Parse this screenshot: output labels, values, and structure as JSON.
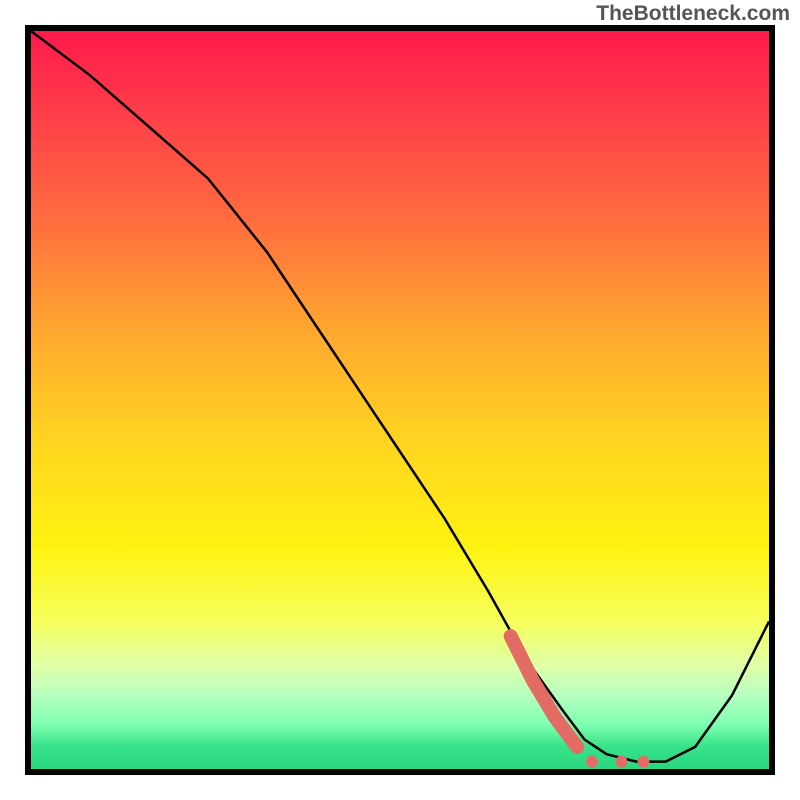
{
  "watermark": "TheBottleneck.com",
  "chart_data": {
    "type": "line",
    "title": "",
    "xlabel": "",
    "ylabel": "",
    "xlim": [
      0,
      100
    ],
    "ylim": [
      0,
      100
    ],
    "series": [
      {
        "name": "bottleneck-curve",
        "x": [
          0,
          8,
          16,
          24,
          32,
          40,
          48,
          56,
          62,
          67,
          72,
          75,
          78,
          82,
          86,
          90,
          95,
          100
        ],
        "values": [
          100,
          94,
          87,
          80,
          70,
          58,
          46,
          34,
          24,
          15,
          8,
          4,
          2,
          1,
          1,
          3,
          10,
          20
        ]
      }
    ],
    "highlight": {
      "name": "optimal-zone",
      "x": [
        65,
        68,
        71,
        74,
        76,
        80,
        83
      ],
      "values": [
        18,
        12,
        7,
        3,
        1,
        1,
        1
      ]
    }
  },
  "colors": {
    "curve": "#000000",
    "highlight": "#e26c64",
    "gradient_top": "#ff1a4c",
    "gradient_bottom": "#2bd77e"
  }
}
